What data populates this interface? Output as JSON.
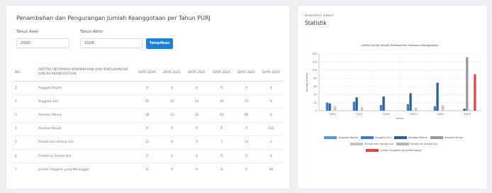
{
  "left": {
    "title": "Penambahan dan Pengurangan Jumlah Keanggotaan per Tahun PURJ",
    "tahun_awal_label": "Tahun Awal",
    "tahun_awal_value": "2020",
    "tahun_akhir_label": "Tahun Akhir",
    "tahun_akhir_value": "2025",
    "button_label": "Tampilkan",
    "table": {
      "headers": {
        "no": "NO.",
        "entity": "ENTITAS INFORMASI PENAMBAHAN DAN PENGURANGAN JUMLAH KEANGGOTAAN",
        "years": [
          "DATA 2020",
          "DATA 2021",
          "DATA 2022",
          "DATA 2023",
          "DATA 2024",
          "DATA 2025"
        ]
      },
      "rows": [
        {
          "no": "1",
          "entity": "Anggota Baptis",
          "values": [
            "0",
            "0",
            "0",
            "0",
            "0",
            "0"
          ]
        },
        {
          "no": "2",
          "entity": "Anggota Sidi",
          "values": [
            "20",
            "22",
            "14",
            "16",
            "11",
            "0"
          ]
        },
        {
          "no": "3",
          "entity": "Atestasi Masuk",
          "values": [
            "18",
            "33",
            "35",
            "43",
            "69",
            "5"
          ]
        },
        {
          "no": "4",
          "entity": "Atestasi Keluar",
          "values": [
            "0",
            "0",
            "0",
            "0",
            "0",
            "132"
          ]
        },
        {
          "no": "5",
          "entity": "Pindah dari Gereja lain",
          "values": [
            "11",
            "9",
            "0",
            "7",
            "13",
            "2"
          ]
        },
        {
          "no": "6",
          "entity": "Pindah ke Gereja lain",
          "values": [
            "0",
            "0",
            "0",
            "0",
            "0",
            "0"
          ]
        },
        {
          "no": "7",
          "entity": "Jumlah Anggota yang Meninggal",
          "values": [
            "0",
            "0",
            "0",
            "0",
            "0",
            "90"
          ]
        }
      ]
    }
  },
  "right": {
    "small_label": "DEMOGRAFI JEMAAT",
    "title": "Statistik"
  },
  "chart_data": {
    "type": "bar",
    "title": "Grafik Jumlah Jemaat Berdasarkan Kategori Keanggotaan",
    "xlabel": "Tahun",
    "ylabel": "Jumlah Jemaat",
    "categories": [
      "2020",
      "2021",
      "2022",
      "2023",
      "2024",
      "2025"
    ],
    "ylim": [
      0,
      140
    ],
    "yticks": [
      "0",
      "20",
      "40",
      "60",
      "80",
      "100",
      "120",
      "140"
    ],
    "grid": true,
    "legend_position": "bottom",
    "series": [
      {
        "name": "Anggota Baptis",
        "color": "#4a9be0",
        "values": [
          0,
          0,
          0,
          0,
          0,
          0
        ]
      },
      {
        "name": "Anggota Sidi",
        "color": "#3a7ec4",
        "values": [
          20,
          22,
          14,
          16,
          11,
          0
        ]
      },
      {
        "name": "Atestasi Masuk",
        "color": "#2c5f93",
        "values": [
          18,
          33,
          35,
          43,
          69,
          5
        ]
      },
      {
        "name": "Atestasi Keluar",
        "color": "#9a9a9a",
        "values": [
          0,
          0,
          0,
          0,
          0,
          132
        ]
      },
      {
        "name": "Pindah dari Gereja lain",
        "color": "#c4c4c4",
        "values": [
          11,
          9,
          0,
          7,
          13,
          2
        ]
      },
      {
        "name": "Pindah ke Gereja lain",
        "color": "#b8b8b8",
        "values": [
          0,
          0,
          0,
          0,
          0,
          0
        ]
      },
      {
        "name": "Jumlah Anggota yang Meninggal",
        "color": "#e04848",
        "values": [
          0,
          0,
          0,
          0,
          0,
          90
        ]
      }
    ]
  }
}
